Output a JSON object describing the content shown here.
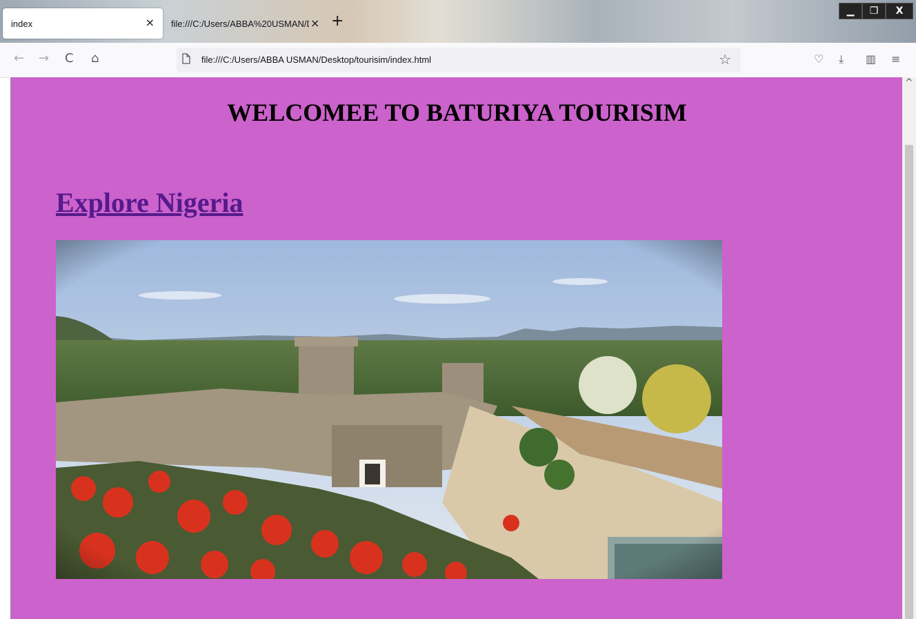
{
  "browser": {
    "tabs": [
      {
        "title": "index",
        "close": "×"
      },
      {
        "title": "file:///C:/Users/ABBA%20USMAN/D",
        "close": "×"
      }
    ],
    "new_tab": "+",
    "window_controls": {
      "minimize": "▁",
      "maximize": "❐",
      "close": "X"
    },
    "nav": {
      "back": "←",
      "forward": "→",
      "reload": "C",
      "home": "⌂"
    },
    "url": "file:///C:/Users/ABBA USMAN/Desktop/tourisim/index.html",
    "bookmark_icon": "☆",
    "toolbar_icons": {
      "pocket": "♡",
      "download": "⤓",
      "sidebar": "▥",
      "menu": "≡"
    }
  },
  "page": {
    "background_color": "#cc62cc",
    "heading": "WELCOMEE TO BATURIYA TOURISIM",
    "link": "Explore Nigeria",
    "link_color": "#551a8b"
  },
  "scrollbar": {
    "up_arrow": "^"
  }
}
